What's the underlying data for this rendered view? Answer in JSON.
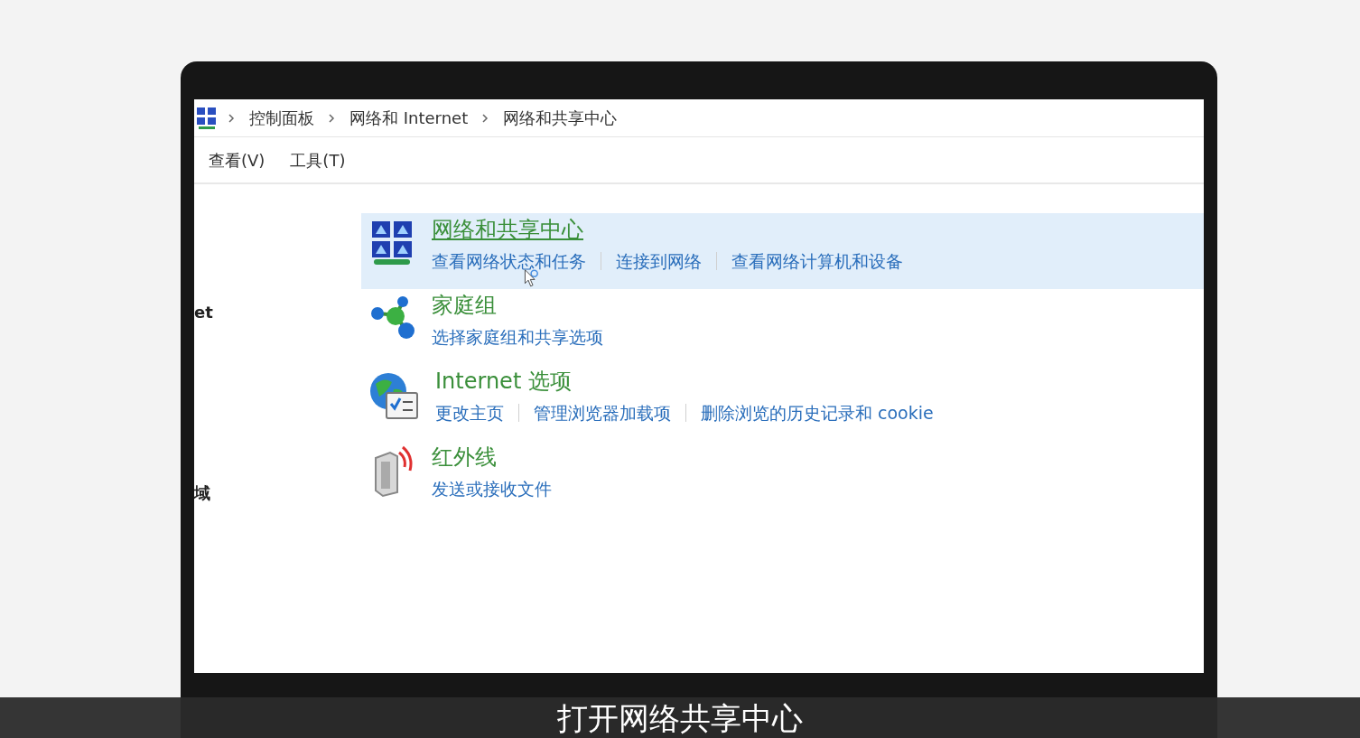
{
  "breadcrumb": [
    "控制面板",
    "网络和 Internet",
    "网络和共享中心"
  ],
  "menu": [
    "查看(V)",
    "工具(T)"
  ],
  "sidebar": [
    "et",
    "域"
  ],
  "items": [
    {
      "title": "网络和共享中心",
      "selected": true,
      "links": [
        "查看网络状态和任务",
        "连接到网络",
        "查看网络计算机和设备"
      ]
    },
    {
      "title": "家庭组",
      "selected": false,
      "links": [
        "选择家庭组和共享选项"
      ]
    },
    {
      "title": "Internet 选项",
      "selected": false,
      "links": [
        "更改主页",
        "管理浏览器加载项",
        "删除浏览的历史记录和 cookie"
      ]
    },
    {
      "title": "红外线",
      "selected": false,
      "links": [
        "发送或接收文件"
      ]
    }
  ],
  "subtitle": "打开网络共享中心"
}
